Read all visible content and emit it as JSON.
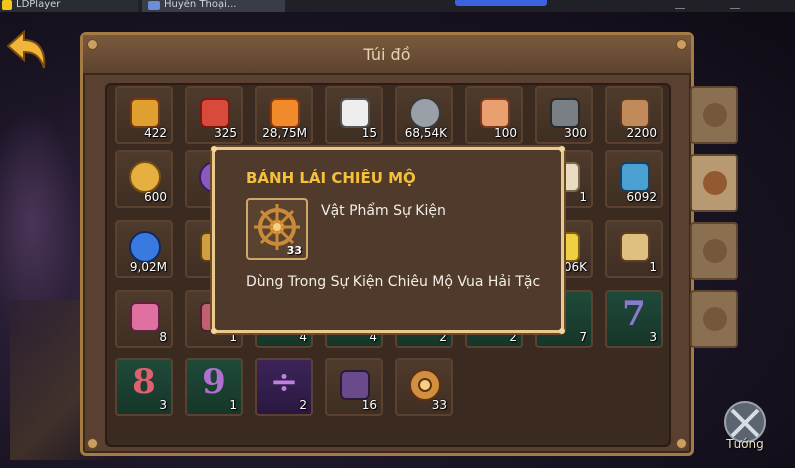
{
  "window": {
    "app_title": "LDPlayer",
    "tab_title": "Huyền Thoại..."
  },
  "panel": {
    "title": "Túi đồ"
  },
  "inventory": [
    {
      "icon": "s-rank-badge-icon",
      "count": "422"
    },
    {
      "icon": "ss-rank-badge-icon",
      "count": "325"
    },
    {
      "icon": "orange-crystal-icon",
      "count": "28,75M"
    },
    {
      "icon": "dice-icon",
      "count": "15"
    },
    {
      "icon": "hammer-coin-icon",
      "count": "68,54K"
    },
    {
      "icon": "noodle-bowl-icon",
      "count": "100"
    },
    {
      "icon": "iron-ingot-icon",
      "count": "300"
    },
    {
      "icon": "wood-plank-icon",
      "count": "2200"
    },
    {
      "icon": "gold-coin-icon",
      "count": "600"
    },
    {
      "icon": "purple-coin-icon",
      "count": ""
    },
    {
      "icon": "hidden-item-icon",
      "count": ""
    },
    {
      "icon": "hidden-item-icon",
      "count": ""
    },
    {
      "icon": "hidden-item-icon",
      "count": ""
    },
    {
      "icon": "hidden-item-icon",
      "count": ""
    },
    {
      "icon": "scroll-icon",
      "count": "1"
    },
    {
      "icon": "photo-card-icon",
      "count": "6092"
    },
    {
      "icon": "blue-gem-icon",
      "count": "9,02M"
    },
    {
      "icon": "gold-item-icon",
      "count": ""
    },
    {
      "icon": "hidden-item-icon",
      "count": ""
    },
    {
      "icon": "hidden-item-icon",
      "count": ""
    },
    {
      "icon": "hidden-item-icon",
      "count": ""
    },
    {
      "icon": "hidden-item-icon",
      "count": ""
    },
    {
      "icon": "star-icon",
      "count": "06K"
    },
    {
      "icon": "skull-key-icon",
      "count": "1"
    },
    {
      "icon": "pirate-hat-icon",
      "count": "8"
    },
    {
      "icon": "character-icon",
      "count": "1"
    },
    {
      "icon": "green-card-icon",
      "count": "4"
    },
    {
      "icon": "green-card-icon",
      "count": "4"
    },
    {
      "icon": "green-card-icon",
      "count": "2"
    },
    {
      "icon": "green-card-icon",
      "count": "2"
    },
    {
      "icon": "green-card-icon",
      "count": "7"
    },
    {
      "icon": "number-seven-icon",
      "glyph": "7",
      "count": "3"
    },
    {
      "icon": "number-eight-icon",
      "glyph": "8",
      "count": "3"
    },
    {
      "icon": "number-nine-icon",
      "glyph": "9",
      "count": "1"
    },
    {
      "icon": "divide-icon",
      "glyph": "÷",
      "count": "2"
    },
    {
      "icon": "treasure-chest-icon",
      "count": "16"
    },
    {
      "icon": "ship-wheel-icon",
      "count": "33"
    }
  ],
  "tooltip": {
    "title": "BÁNH LÁI CHIÊU MỘ",
    "item_count": "33",
    "item_type": "Vật Phẩm Sự Kiện",
    "description": "Dùng Trong Sự Kiện Chiêu Mộ Vua Hải Tặc"
  },
  "side_tabs": [
    {
      "icon": "crossed-swords-icon"
    },
    {
      "icon": "potion-icon"
    },
    {
      "icon": "puzzle-icon"
    },
    {
      "icon": "coin-icon"
    }
  ],
  "hero_button": {
    "label": "Tướng"
  },
  "colors": {
    "panel": "#5a4030",
    "border": "#a47a45",
    "tooltip_title": "#f5c13a",
    "green_card": "#1f4a3a",
    "purple_card": "#3c2459"
  }
}
